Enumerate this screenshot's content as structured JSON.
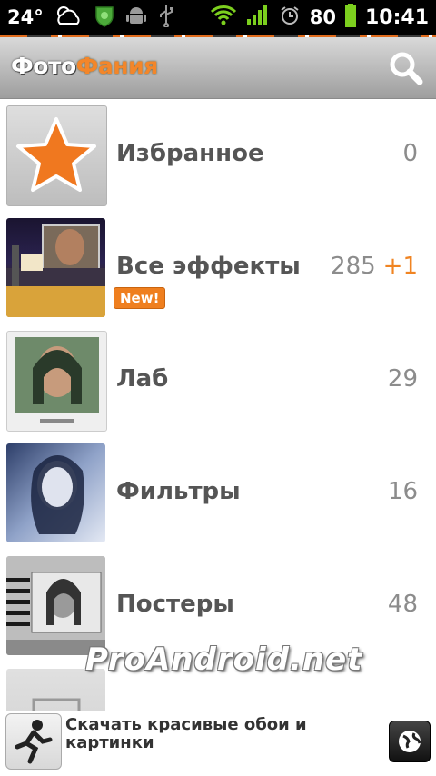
{
  "status_bar": {
    "temperature": "24°",
    "battery_percent": "80",
    "time": "10:41"
  },
  "app": {
    "logo_part1": "Фото",
    "logo_part2": "Фания"
  },
  "list": [
    {
      "label": "Избранное",
      "count": "0"
    },
    {
      "label": "Все эффекты",
      "count": "285",
      "delta": "+1",
      "badge": "New!"
    },
    {
      "label": "Лаб",
      "count": "29"
    },
    {
      "label": "Фильтры",
      "count": "16"
    },
    {
      "label": "Постеры",
      "count": "48"
    }
  ],
  "watermark": "ProAndroid.net",
  "ad": {
    "text": "Скачать красивые обои и картинки"
  },
  "colors": {
    "accent": "#f08422",
    "text": "#555555",
    "count": "#8c8c8c"
  }
}
